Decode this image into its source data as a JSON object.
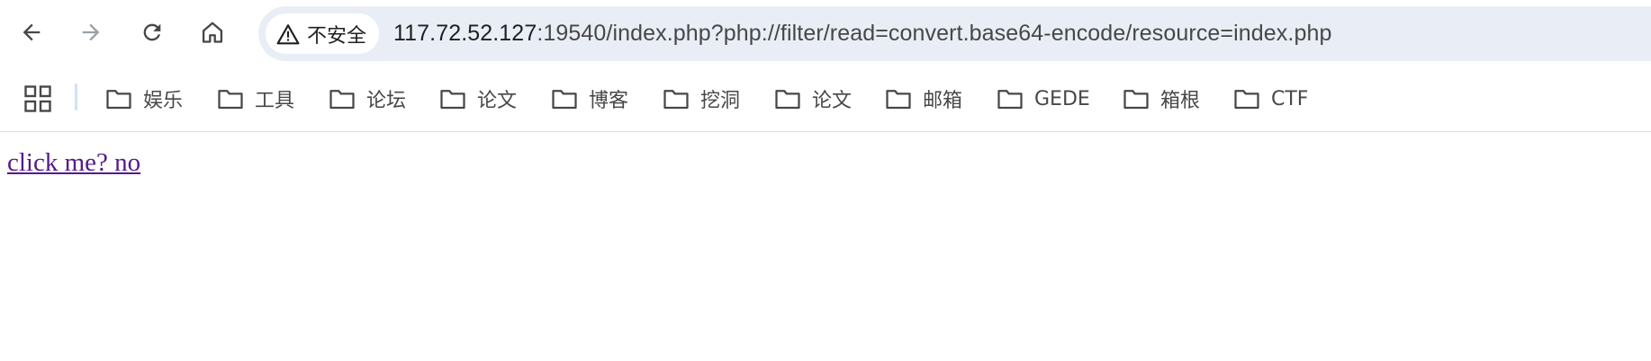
{
  "toolbar": {
    "buttons": {
      "back": "back-arrow-icon",
      "forward": "forward-arrow-icon",
      "reload": "reload-icon",
      "home": "home-icon"
    },
    "security_chip": {
      "icon": "warning-triangle-icon",
      "label": "不安全"
    },
    "url": {
      "host": "117.72.52.127",
      "rest": ":19540/index.php?php://filter/read=convert.base64-encode/resource=index.php"
    }
  },
  "bookmarks_bar": {
    "apps_icon": "apps-grid-icon",
    "items": [
      {
        "label": "娱乐",
        "icon": "folder-icon"
      },
      {
        "label": "工具",
        "icon": "folder-icon"
      },
      {
        "label": "论坛",
        "icon": "folder-icon"
      },
      {
        "label": "论文",
        "icon": "folder-icon"
      },
      {
        "label": "博客",
        "icon": "folder-icon"
      },
      {
        "label": "挖洞",
        "icon": "folder-icon"
      },
      {
        "label": "论文",
        "icon": "folder-icon"
      },
      {
        "label": "邮箱",
        "icon": "folder-icon"
      },
      {
        "label": "GEDE",
        "icon": "folder-icon"
      },
      {
        "label": "箱根",
        "icon": "folder-icon"
      },
      {
        "label": "CTF",
        "icon": "folder-icon"
      }
    ]
  },
  "page": {
    "link_text": "click me? no"
  },
  "colors": {
    "omnibox_bg": "#e9eef6",
    "visited_link": "#551a8b",
    "icon": "#474747",
    "disabled_icon": "#9aa0a6"
  }
}
